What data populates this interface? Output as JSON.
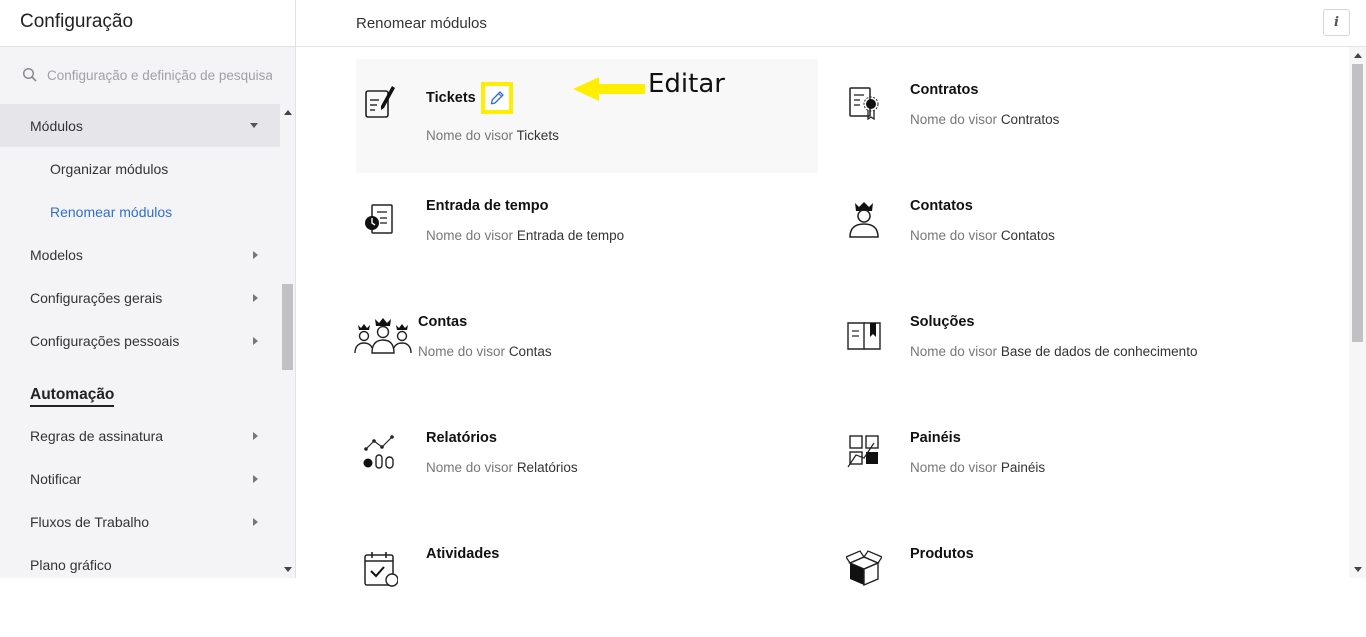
{
  "sidebar": {
    "title": "Configuração",
    "search_placeholder": "Configuração e definição de pesquisa",
    "items": [
      {
        "label": "Módulos"
      },
      {
        "label": "Organizar módulos"
      },
      {
        "label": "Renomear módulos"
      },
      {
        "label": "Modelos"
      },
      {
        "label": "Configurações gerais"
      },
      {
        "label": "Configurações pessoais"
      }
    ],
    "section_automation": "Automação",
    "automation_items": [
      {
        "label": "Regras de assinatura"
      },
      {
        "label": "Notificar"
      },
      {
        "label": "Fluxos de Trabalho"
      },
      {
        "label": "Plano gráfico"
      }
    ]
  },
  "main": {
    "title": "Renomear módulos",
    "info_label": "i",
    "display_label": "Nome do visor",
    "modules": [
      {
        "name": "Tickets",
        "display": "Tickets",
        "icon": "ticket-edit-icon"
      },
      {
        "name": "Contratos",
        "display": "Contratos",
        "icon": "contract-icon"
      },
      {
        "name": "Entrada de tempo",
        "display": "Entrada de tempo",
        "icon": "time-entry-icon"
      },
      {
        "name": "Contatos",
        "display": "Contatos",
        "icon": "contact-icon"
      },
      {
        "name": "Contas",
        "display": "Contas",
        "icon": "accounts-icon"
      },
      {
        "name": "Soluções",
        "display": "Base de dados de conhecimento",
        "icon": "book-icon"
      },
      {
        "name": "Relatórios",
        "display": "Relatórios",
        "icon": "reports-icon"
      },
      {
        "name": "Painéis",
        "display": "Painéis",
        "icon": "dashboard-icon"
      },
      {
        "name": "Atividades",
        "display": "",
        "icon": "calendar-icon"
      },
      {
        "name": "Produtos",
        "display": "",
        "icon": "box-icon"
      }
    ]
  },
  "annotation": {
    "label": "Editar",
    "color": "#ffee00"
  },
  "colors": {
    "accent": "#2f6fd0"
  }
}
